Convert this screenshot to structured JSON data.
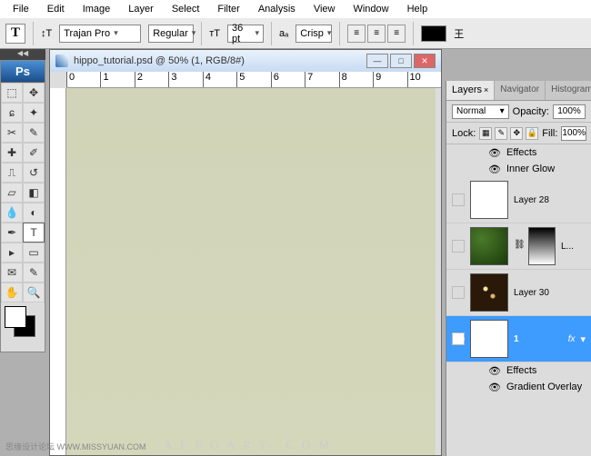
{
  "menu": [
    "File",
    "Edit",
    "Image",
    "Layer",
    "Select",
    "Filter",
    "Analysis",
    "View",
    "Window",
    "Help"
  ],
  "options": {
    "tool_glyph": "T",
    "orient_glyph": "↕T",
    "font": "Trajan Pro",
    "style": "Regular",
    "size_icon": "тT",
    "size": "36 pt",
    "aa_label": "aₐ",
    "aa": "Crisp"
  },
  "doc": {
    "title": "hippo_tutorial.psd @ 50% (1, RGB/8#)",
    "ruler_marks": [
      "0",
      "1",
      "2",
      "3",
      "4",
      "5",
      "6",
      "7",
      "8",
      "9",
      "10"
    ]
  },
  "panels": {
    "tabs": [
      "Layers",
      "Navigator",
      "Histogram"
    ],
    "blend_mode": "Normal",
    "opacity_label": "Opacity:",
    "opacity": "100%",
    "lock_label": "Lock:",
    "fill_label": "Fill:",
    "fill": "100%",
    "effects_label": "Effects",
    "inner_glow": "Inner Glow",
    "gradient_overlay": "Gradient Overlay",
    "layers": [
      {
        "name": "Layer 28"
      },
      {
        "name": "L..."
      },
      {
        "name": "Layer 30"
      },
      {
        "name": "1"
      }
    ],
    "fx": "fx"
  },
  "ps_logo": "Ps",
  "watermark1": "思缘设计论坛 WWW.MISSYUAN.COM",
  "watermark2": "A L F O A R T . C O M"
}
